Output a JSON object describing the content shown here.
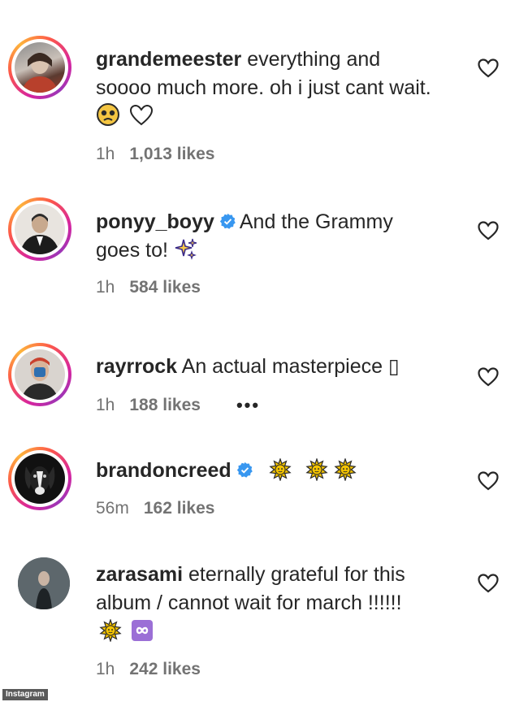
{
  "comments": [
    {
      "username": "grandemeester",
      "text": " everything and soooo much more. oh i just cant wait. ",
      "emoji": [
        "pleading-face",
        "white-heart"
      ],
      "time": "1h",
      "likes": "1,013 likes",
      "verified": false
    },
    {
      "username": "ponyy_boyy",
      "text": "And the Grammy goes to! ",
      "emoji": [
        "sparkles"
      ],
      "time": "1h",
      "likes": "584 likes",
      "verified": true
    },
    {
      "username": "rayrrock",
      "text": " An actual masterpiece ",
      "emoji": [
        "missing-glyph"
      ],
      "missing_glyph": "▯",
      "time": "1h",
      "likes": "188 likes",
      "more": "•••",
      "verified": false
    },
    {
      "username": "brandoncreed",
      "text": "",
      "emoji": [
        "sun-with-face",
        "sun-with-face",
        "sun-with-face"
      ],
      "time": "56m",
      "likes": "162 likes",
      "verified": true
    },
    {
      "username": "zarasami",
      "text": " eternally grateful for this album / cannot wait for march !!!!!! ",
      "emoji": [
        "sun-with-face",
        "infinity"
      ],
      "time": "1h",
      "likes": "242 likes",
      "verified": false
    }
  ],
  "credit": "Instagram",
  "colors": {
    "verified": "#3897f0",
    "muted": "#737373",
    "text": "#262626",
    "infinity_bg": "#9b6fd6"
  }
}
